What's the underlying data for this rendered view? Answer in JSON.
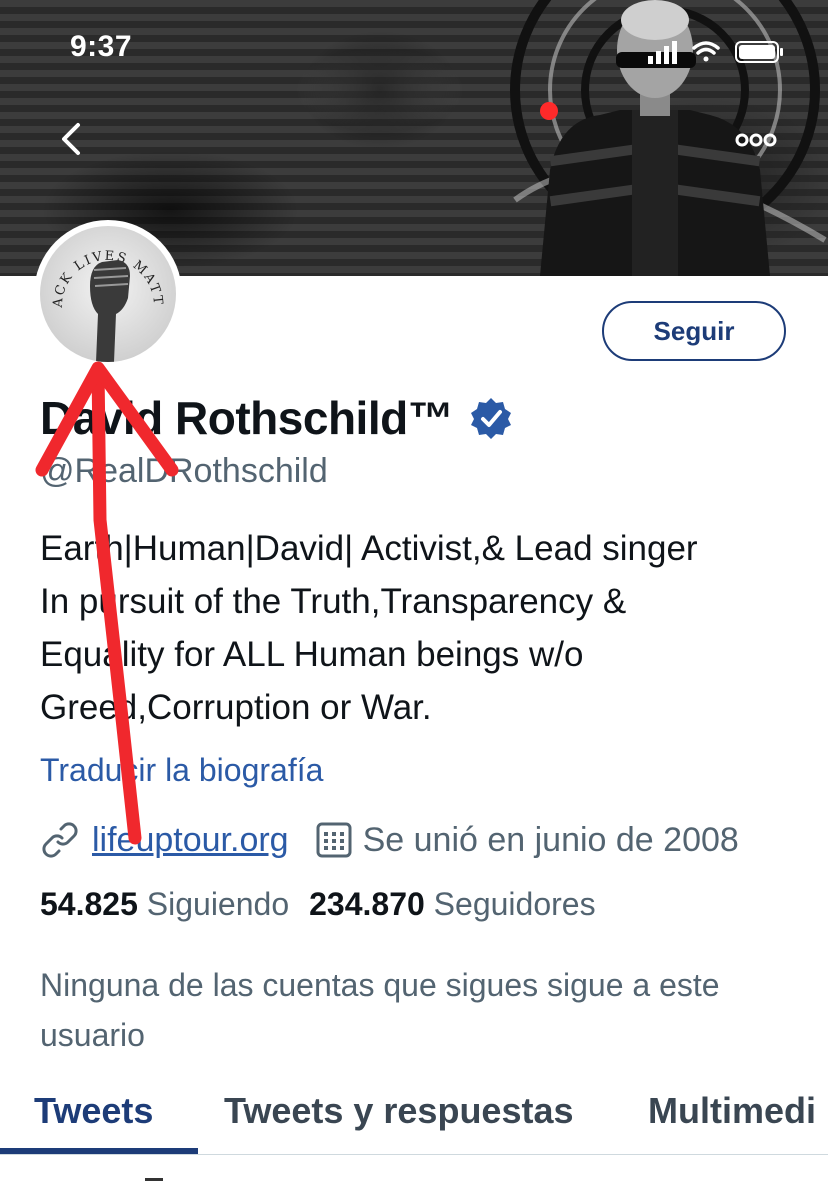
{
  "status_bar": {
    "time": "9:37"
  },
  "header": {
    "back_icon": "chevron-left-icon",
    "more_icon": "more-horizontal-icon"
  },
  "profile": {
    "avatar_text": "BLACK LIVES MATTER",
    "name": "David Rothschild™",
    "verified_icon": "verified-badge-icon",
    "handle": "@RealDRothschild",
    "follow_label": "Seguir",
    "bio_lines": [
      "Earth|Human|David| Activist,& Lead singer",
      "In pursuit of the Truth,Transparency &",
      "Equality for ALL Human beings w/o",
      "Greed,Corruption or War."
    ],
    "translate_label": "Traducir la biografía",
    "website": "lifeuptour.org",
    "joined": "Se unió en junio de 2008",
    "following_count": "54.825",
    "following_label": "Siguiendo",
    "followers_count": "234.870",
    "followers_label": "Seguidores",
    "followed_by_note": "Ninguna de las cuentas que sigues sigue a este usuario"
  },
  "tabs": [
    {
      "label": "Tweets",
      "active": true
    },
    {
      "label": "Tweets y respuestas",
      "active": false
    },
    {
      "label": "Multimedi",
      "active": false
    }
  ],
  "colors": {
    "accent": "#1d3c78",
    "link": "#2b5aa6",
    "secondary_text": "#536471",
    "annotation_arrow": "#f0282d"
  }
}
